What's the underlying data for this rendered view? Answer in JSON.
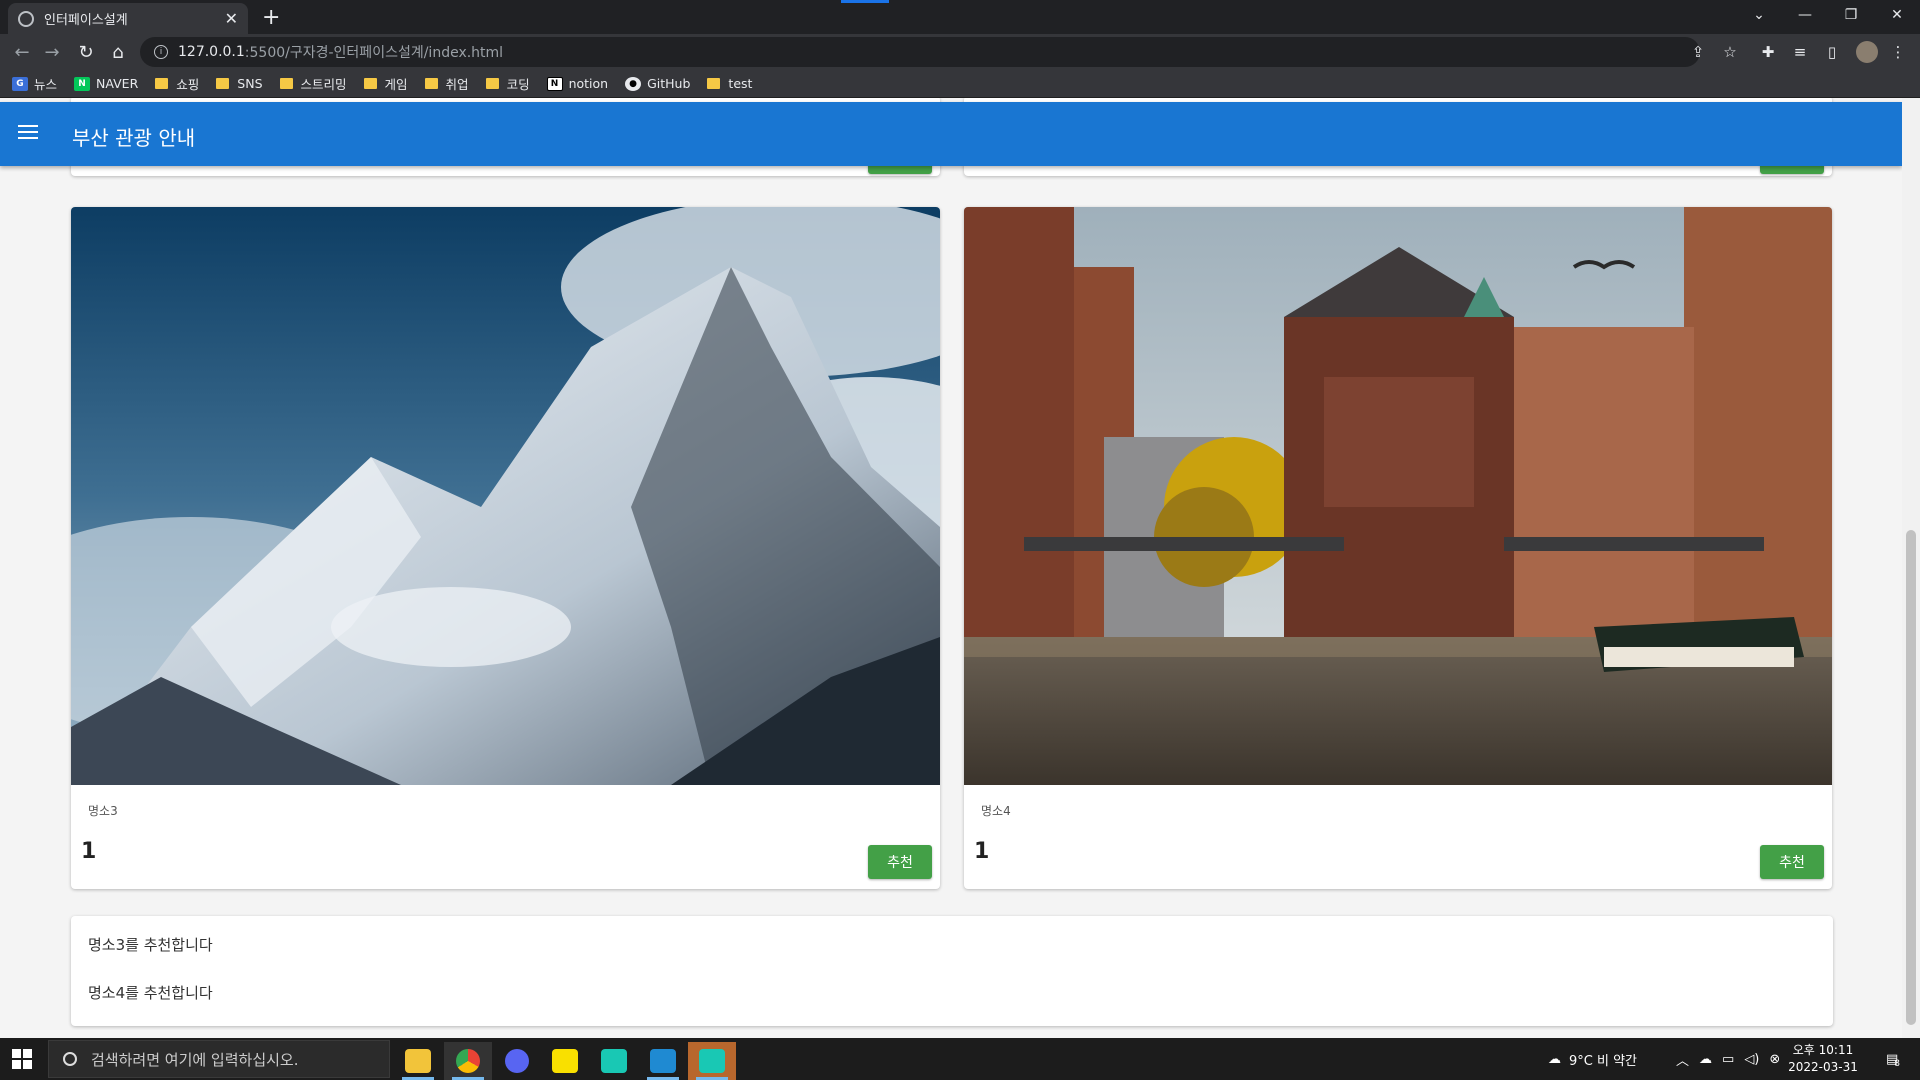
{
  "browser": {
    "tab_title": "인터페이스설계",
    "url_host": "127.0.0.1",
    "url_path": ":5500/구자경-인터페이스설계/index.html",
    "bookmarks": [
      "뉴스",
      "NAVER",
      "쇼핑",
      "SNS",
      "스트리밍",
      "게임",
      "취업",
      "코딩",
      "notion",
      "GitHub",
      "test"
    ]
  },
  "app": {
    "title": "부산 관광 안내",
    "accent": "#1976d2",
    "button_color": "#43a047"
  },
  "cards": [
    {
      "name": "명소3",
      "count": "1",
      "button": "추천",
      "image": "snowy-mountain-photo"
    },
    {
      "name": "명소4",
      "count": "1",
      "button": "추천",
      "image": "canal-city-photo"
    }
  ],
  "results": {
    "lines": [
      "명소3를 추천합니다",
      "명소4를 추천합니다"
    ]
  },
  "taskbar": {
    "search_placeholder": "검색하려면 여기에 입력하십시오.",
    "weather": "9°C  비 약간",
    "time": "오후 10:11",
    "date": "2022-03-31",
    "notification_count": "8"
  }
}
